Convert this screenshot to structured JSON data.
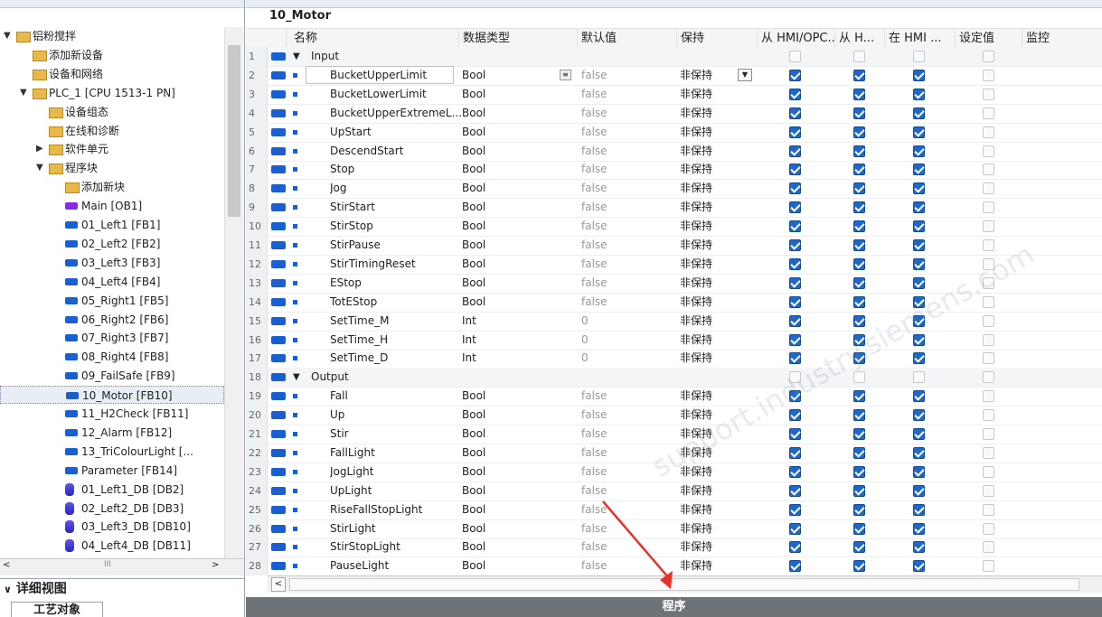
{
  "tree": {
    "items": [
      {
        "label": "铝粉搅拌",
        "indent": 0,
        "arrow": "▼",
        "icon": "project-icon"
      },
      {
        "label": "添加新设备",
        "indent": 1,
        "arrow": "",
        "icon": "add-device-icon"
      },
      {
        "label": "设备和网络",
        "indent": 1,
        "arrow": "",
        "icon": "network-icon"
      },
      {
        "label": "PLC_1 [CPU 1513-1 PN]",
        "indent": 1,
        "arrow": "▼",
        "icon": "plc-icon"
      },
      {
        "label": "设备组态",
        "indent": 2,
        "arrow": "",
        "icon": "device-config-icon"
      },
      {
        "label": "在线和诊断",
        "indent": 2,
        "arrow": "",
        "icon": "online-diagnostics-icon"
      },
      {
        "label": "软件单元",
        "indent": 2,
        "arrow": "▶",
        "icon": "software-units-icon"
      },
      {
        "label": "程序块",
        "indent": 2,
        "arrow": "▼",
        "icon": "program-blocks-icon"
      },
      {
        "label": "添加新块",
        "indent": 3,
        "arrow": "",
        "icon": "add-block-icon"
      },
      {
        "label": "Main [OB1]",
        "indent": 3,
        "arrow": "",
        "icon": "ob-icon"
      },
      {
        "label": "01_Left1 [FB1]",
        "indent": 3,
        "arrow": "",
        "icon": "fb-icon"
      },
      {
        "label": "02_Left2 [FB2]",
        "indent": 3,
        "arrow": "",
        "icon": "fb-icon"
      },
      {
        "label": "03_Left3 [FB3]",
        "indent": 3,
        "arrow": "",
        "icon": "fb-icon"
      },
      {
        "label": "04_Left4 [FB4]",
        "indent": 3,
        "arrow": "",
        "icon": "fb-icon"
      },
      {
        "label": "05_Right1 [FB5]",
        "indent": 3,
        "arrow": "",
        "icon": "fb-icon"
      },
      {
        "label": "06_Right2 [FB6]",
        "indent": 3,
        "arrow": "",
        "icon": "fb-icon"
      },
      {
        "label": "07_Right3 [FB7]",
        "indent": 3,
        "arrow": "",
        "icon": "fb-icon"
      },
      {
        "label": "08_Right4 [FB8]",
        "indent": 3,
        "arrow": "",
        "icon": "fb-icon"
      },
      {
        "label": "09_FailSafe [FB9]",
        "indent": 3,
        "arrow": "",
        "icon": "fb-icon"
      },
      {
        "label": "10_Motor [FB10]",
        "indent": 3,
        "arrow": "",
        "icon": "fb-icon",
        "selected": true
      },
      {
        "label": "11_H2Check [FB11]",
        "indent": 3,
        "arrow": "",
        "icon": "fb-icon"
      },
      {
        "label": "12_Alarm [FB12]",
        "indent": 3,
        "arrow": "",
        "icon": "fb-icon"
      },
      {
        "label": "13_TriColourLight [...",
        "indent": 3,
        "arrow": "",
        "icon": "fb-icon"
      },
      {
        "label": "Parameter [FB14]",
        "indent": 3,
        "arrow": "",
        "icon": "fb-icon"
      },
      {
        "label": "01_Left1_DB [DB2]",
        "indent": 3,
        "arrow": "",
        "icon": "db-icon"
      },
      {
        "label": "02_Left2_DB [DB3]",
        "indent": 3,
        "arrow": "",
        "icon": "db-icon"
      },
      {
        "label": "03_Left3_DB [DB10]",
        "indent": 3,
        "arrow": "",
        "icon": "db-icon"
      },
      {
        "label": "04_Left4_DB [DB11]",
        "indent": 3,
        "arrow": "",
        "icon": "db-icon"
      }
    ],
    "scroll_label": "III",
    "detail_view": "详细视图",
    "tech_objects": "工艺对象"
  },
  "editor": {
    "block_title": "10_Motor",
    "columns": [
      "名称",
      "数据类型",
      "默认值",
      "保持",
      "从 HMI/OPC...",
      "从 H...",
      "在 HMI ...",
      "设定值",
      "监控"
    ],
    "rows": [
      {
        "n": "1",
        "section": true,
        "name": "Input",
        "type": "",
        "default": "",
        "retain": "",
        "c1": false,
        "c2": false,
        "c3": false
      },
      {
        "n": "2",
        "name": "BucketUpperLimit",
        "type": "Bool",
        "default": "false",
        "retain": "非保持",
        "c1": true,
        "c2": true,
        "c3": true,
        "editing": true
      },
      {
        "n": "3",
        "name": "BucketLowerLimit",
        "type": "Bool",
        "default": "false",
        "retain": "非保持",
        "c1": true,
        "c2": true,
        "c3": true
      },
      {
        "n": "4",
        "name": "BucketUpperExtremeL...",
        "type": "Bool",
        "default": "false",
        "retain": "非保持",
        "c1": true,
        "c2": true,
        "c3": true
      },
      {
        "n": "5",
        "name": "UpStart",
        "type": "Bool",
        "default": "false",
        "retain": "非保持",
        "c1": true,
        "c2": true,
        "c3": true
      },
      {
        "n": "6",
        "name": "DescendStart",
        "type": "Bool",
        "default": "false",
        "retain": "非保持",
        "c1": true,
        "c2": true,
        "c3": true
      },
      {
        "n": "7",
        "name": "Stop",
        "type": "Bool",
        "default": "false",
        "retain": "非保持",
        "c1": true,
        "c2": true,
        "c3": true
      },
      {
        "n": "8",
        "name": "Jog",
        "type": "Bool",
        "default": "false",
        "retain": "非保持",
        "c1": true,
        "c2": true,
        "c3": true
      },
      {
        "n": "9",
        "name": "StirStart",
        "type": "Bool",
        "default": "false",
        "retain": "非保持",
        "c1": true,
        "c2": true,
        "c3": true
      },
      {
        "n": "10",
        "name": "StirStop",
        "type": "Bool",
        "default": "false",
        "retain": "非保持",
        "c1": true,
        "c2": true,
        "c3": true
      },
      {
        "n": "11",
        "name": "StirPause",
        "type": "Bool",
        "default": "false",
        "retain": "非保持",
        "c1": true,
        "c2": true,
        "c3": true
      },
      {
        "n": "12",
        "name": "StirTimingReset",
        "type": "Bool",
        "default": "false",
        "retain": "非保持",
        "c1": true,
        "c2": true,
        "c3": true
      },
      {
        "n": "13",
        "name": "EStop",
        "type": "Bool",
        "default": "false",
        "retain": "非保持",
        "c1": true,
        "c2": true,
        "c3": true
      },
      {
        "n": "14",
        "name": "TotEStop",
        "type": "Bool",
        "default": "false",
        "retain": "非保持",
        "c1": true,
        "c2": true,
        "c3": true
      },
      {
        "n": "15",
        "name": "SetTime_M",
        "type": "Int",
        "default": "0",
        "retain": "非保持",
        "c1": true,
        "c2": true,
        "c3": true
      },
      {
        "n": "16",
        "name": "SetTime_H",
        "type": "Int",
        "default": "0",
        "retain": "非保持",
        "c1": true,
        "c2": true,
        "c3": true
      },
      {
        "n": "17",
        "name": "SetTime_D",
        "type": "Int",
        "default": "0",
        "retain": "非保持",
        "c1": true,
        "c2": true,
        "c3": true
      },
      {
        "n": "18",
        "section": true,
        "name": "Output",
        "type": "",
        "default": "",
        "retain": "",
        "c1": false,
        "c2": false,
        "c3": false
      },
      {
        "n": "19",
        "name": "Fall",
        "type": "Bool",
        "default": "false",
        "retain": "非保持",
        "c1": true,
        "c2": true,
        "c3": true
      },
      {
        "n": "20",
        "name": "Up",
        "type": "Bool",
        "default": "false",
        "retain": "非保持",
        "c1": true,
        "c2": true,
        "c3": true
      },
      {
        "n": "21",
        "name": "Stir",
        "type": "Bool",
        "default": "false",
        "retain": "非保持",
        "c1": true,
        "c2": true,
        "c3": true
      },
      {
        "n": "22",
        "name": "FallLight",
        "type": "Bool",
        "default": "false",
        "retain": "非保持",
        "c1": true,
        "c2": true,
        "c3": true
      },
      {
        "n": "23",
        "name": "JogLight",
        "type": "Bool",
        "default": "false",
        "retain": "非保持",
        "c1": true,
        "c2": true,
        "c3": true
      },
      {
        "n": "24",
        "name": "UpLight",
        "type": "Bool",
        "default": "false",
        "retain": "非保持",
        "c1": true,
        "c2": true,
        "c3": true
      },
      {
        "n": "25",
        "name": "RiseFallStopLight",
        "type": "Bool",
        "default": "false",
        "retain": "非保持",
        "c1": true,
        "c2": true,
        "c3": true
      },
      {
        "n": "26",
        "name": "StirLight",
        "type": "Bool",
        "default": "false",
        "retain": "非保持",
        "c1": true,
        "c2": true,
        "c3": true
      },
      {
        "n": "27",
        "name": "StirStopLight",
        "type": "Bool",
        "default": "false",
        "retain": "非保持",
        "c1": true,
        "c2": true,
        "c3": true
      },
      {
        "n": "28",
        "name": "PauseLight",
        "type": "Bool",
        "default": "false",
        "retain": "非保持",
        "c1": true,
        "c2": true,
        "c3": true
      }
    ],
    "status_label": "程序",
    "checkbox_color": "#1e68c9",
    "statusbar_color": "#6e7378"
  }
}
